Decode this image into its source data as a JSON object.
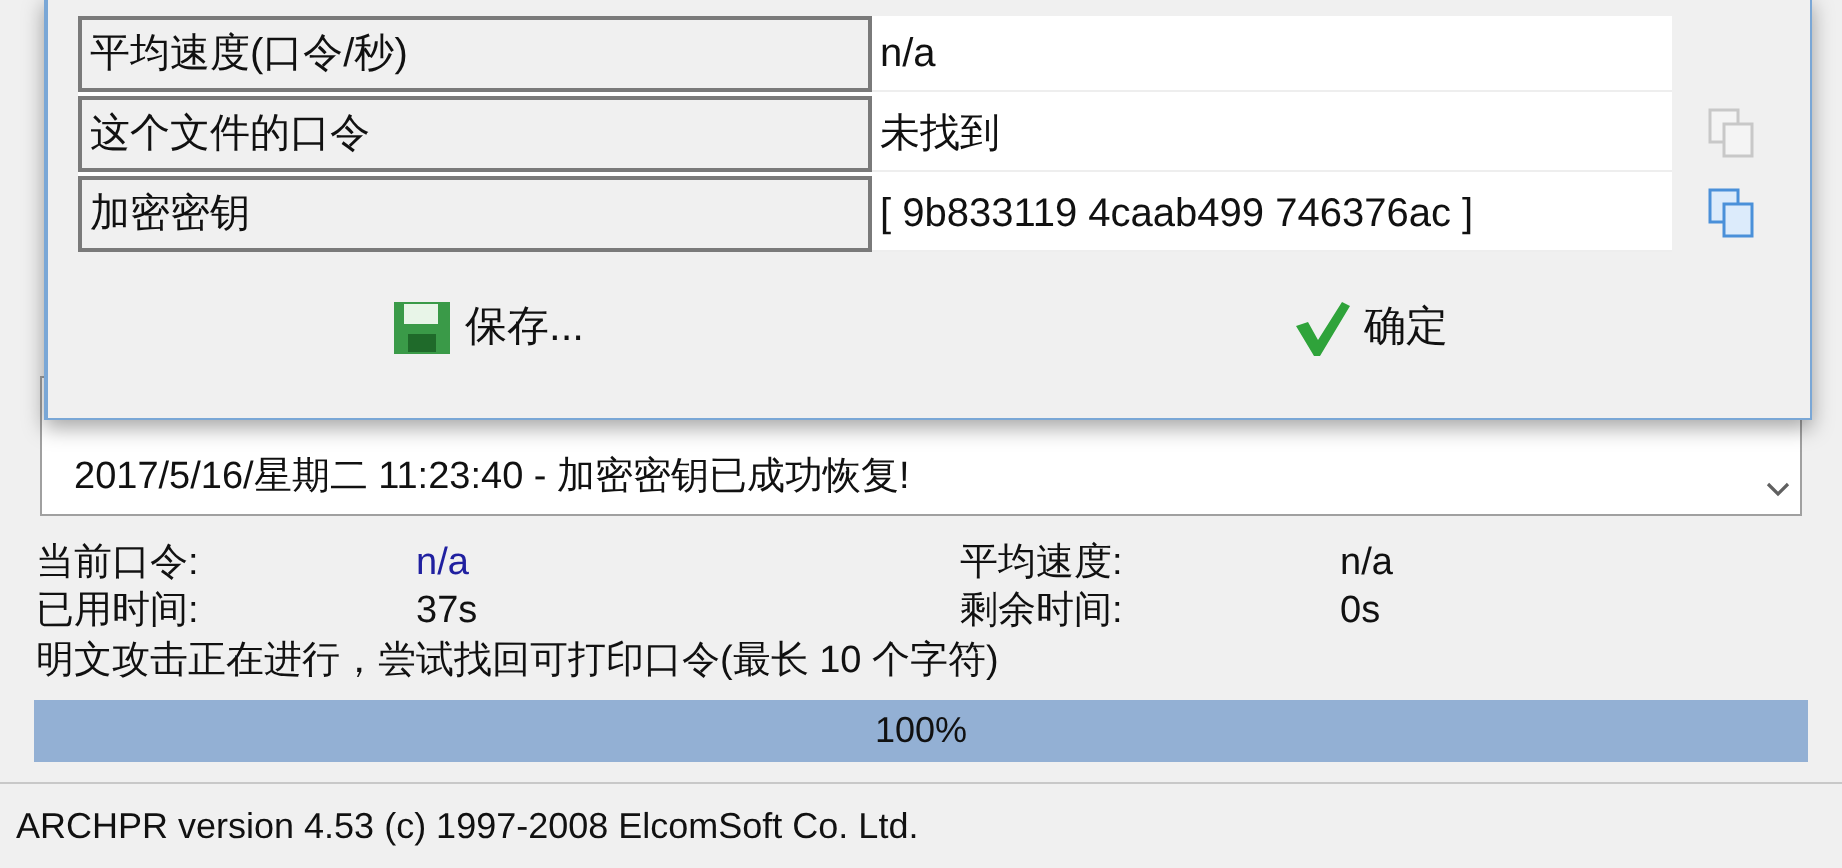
{
  "dialog": {
    "rows": [
      {
        "label": "平均速度(口令/秒)",
        "value": "n/a"
      },
      {
        "label": "这个文件的口令",
        "value": "未找到",
        "copy": {
          "disabled": true
        }
      },
      {
        "label": "加密密钥",
        "value": "[ 9b833119 4caab499 746376ac ]",
        "copy": {
          "disabled": false
        }
      }
    ],
    "buttons": [
      {
        "kind": "save",
        "label": "保存..."
      },
      {
        "kind": "ok",
        "label": "确定"
      }
    ]
  },
  "log": {
    "lines": [
      "2017/5/16/星期二 11:23:40 - 加密密钥已成功恢复!"
    ]
  },
  "stats": [
    {
      "label": "当前口令:",
      "value": "n/a",
      "kind": "password"
    },
    {
      "label": "平均速度:",
      "value": "n/a",
      "kind": "plain"
    },
    {
      "label": "已用时间:",
      "value": "37s",
      "kind": "plain"
    },
    {
      "label": "剩余时间:",
      "value": "0s",
      "kind": "plain"
    }
  ],
  "status_text": "明文攻击正在进行，尝试找回可打印口令(最长 10 个字符)",
  "progress": {
    "level": 1,
    "label": "100%"
  },
  "status_bar": "ARCHPR version 4.53 (c) 1997-2008 ElcomSoft Co. Ltd."
}
